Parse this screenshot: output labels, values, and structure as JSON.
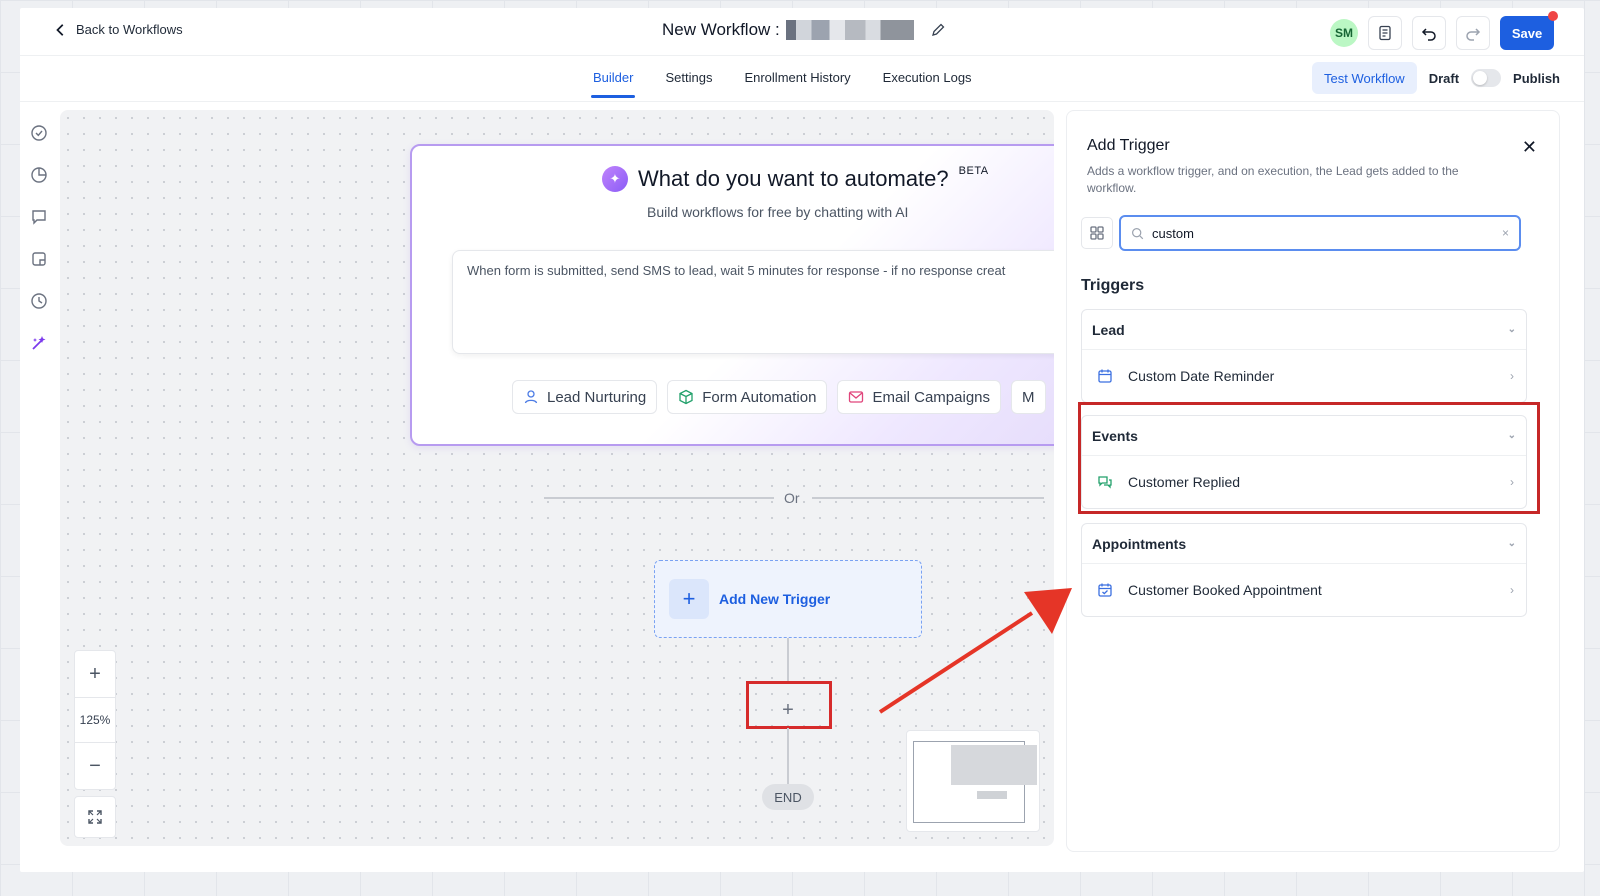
{
  "header": {
    "back_label": "Back to Workflows",
    "workflow_title": "New Workflow :",
    "avatar_initials": "SM",
    "save_label": "Save"
  },
  "tabs": [
    {
      "label": "Builder",
      "active": true
    },
    {
      "label": "Settings",
      "active": false
    },
    {
      "label": "Enrollment History",
      "active": false
    },
    {
      "label": "Execution Logs",
      "active": false
    }
  ],
  "tab_actions": {
    "test_workflow": "Test Workflow",
    "draft": "Draft",
    "publish": "Publish"
  },
  "ai_card": {
    "title": "What do you want to automate?",
    "badge": "BETA",
    "subtitle": "Build workflows for free by chatting with AI",
    "prompt_text": "When form is submitted, send SMS to lead, wait 5 minutes for response - if no response creat",
    "chips": [
      {
        "label": "Lead Nurturing",
        "icon": "user-icon"
      },
      {
        "label": "Form Automation",
        "icon": "cube-icon"
      },
      {
        "label": "Email Campaigns",
        "icon": "mail-icon"
      },
      {
        "label": "M",
        "icon": ""
      }
    ]
  },
  "canvas": {
    "or_text": "Or",
    "add_trigger_label": "Add New Trigger",
    "add_node_symbol": "+",
    "end_label": "END",
    "zoom_level": "125%",
    "zoom_in": "+",
    "zoom_out": "−"
  },
  "panel": {
    "title": "Add Trigger",
    "close_symbol": "✕",
    "description": "Adds a workflow trigger, and on execution, the Lead gets added to the workflow.",
    "search_value": "custom",
    "search_clear": "×",
    "section_title": "Triggers",
    "groups": [
      {
        "name": "Lead",
        "items": [
          {
            "label": "Custom Date Reminder",
            "icon": "calendar-icon"
          }
        ]
      },
      {
        "name": "Events",
        "items": [
          {
            "label": "Customer Replied",
            "icon": "chat-icon"
          }
        ]
      },
      {
        "name": "Appointments",
        "items": [
          {
            "label": "Customer Booked Appointment",
            "icon": "calendar-check-icon"
          }
        ]
      }
    ]
  },
  "colors": {
    "primary": "#1d5fe0",
    "annotation_red": "#d62b2b",
    "ai_border": "#b79bf0"
  }
}
